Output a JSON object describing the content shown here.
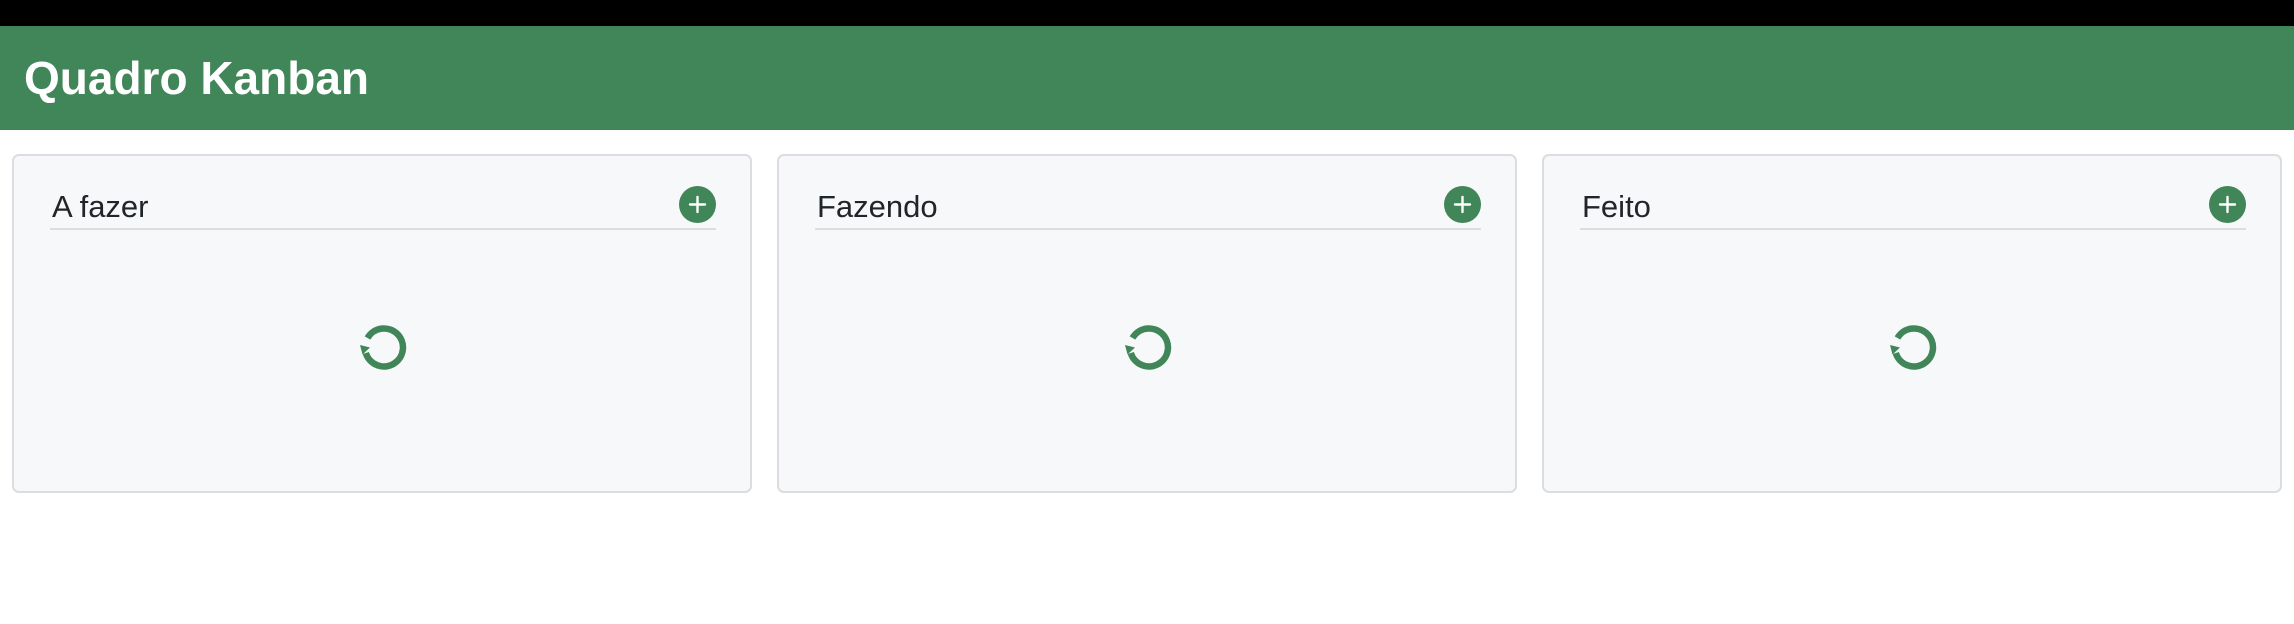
{
  "app": {
    "title": "Quadro Kanban"
  },
  "colors": {
    "brand": "#418658",
    "column_bg": "#f7f8fa",
    "border": "#dcdde0",
    "text": "#212529"
  },
  "columns": [
    {
      "title": "A fazer",
      "add_icon": "plus-circle-icon",
      "status_icon": "loading-spinner-icon"
    },
    {
      "title": "Fazendo",
      "add_icon": "plus-circle-icon",
      "status_icon": "loading-spinner-icon"
    },
    {
      "title": "Feito",
      "add_icon": "plus-circle-icon",
      "status_icon": "loading-spinner-icon"
    }
  ]
}
